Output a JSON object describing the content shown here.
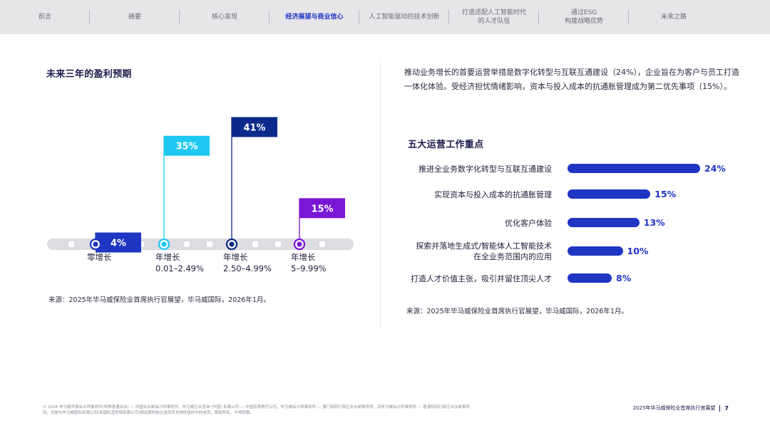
{
  "nav": {
    "items": [
      {
        "label": "前言"
      },
      {
        "label": "摘要"
      },
      {
        "label": "核心发现"
      },
      {
        "label": "经济展望与商业信心",
        "active": true
      },
      {
        "label": "人工智能驱动的技术创新"
      },
      {
        "label": "打造适配人工智能时代\n的人才队伍"
      },
      {
        "label": "通过ESG\n构建战略优势"
      },
      {
        "label": "未来之路"
      }
    ]
  },
  "left": {
    "title": "未来三年的盈利预期",
    "source": "来源：2025年毕马威保险业首席执行官展望，毕马威国际，2026年1月。"
  },
  "right": {
    "intro": "推动业务增长的首要运营举措是数字化转型与互联互通建设（24%），企业旨在为客户与员工打造一体化体验。受经济担忧情绪影响，资本与投入成本的抗通胀管理成为第二优先事项（15%）。",
    "title": "五大运营工作重点",
    "source": "来源：2025年毕马威保险业首席执行官展望，毕马威国际，2026年1月。"
  },
  "chart_data": [
    {
      "type": "bar",
      "categories": [
        "零增长",
        "年增长\n0.01–2.49%",
        "年增长\n2.50–4.99%",
        "年增长\n5–9.99%"
      ],
      "values": [
        4,
        35,
        41,
        15
      ],
      "value_labels": [
        "4%",
        "35%",
        "41%",
        "15%"
      ],
      "colors": [
        "#1f35c4",
        "#1ec8f0",
        "#0b2a8c",
        "#7a16d6"
      ],
      "title": "未来三年的盈利预期",
      "xlabel": "",
      "ylabel": "",
      "ylim": [
        0,
        45
      ],
      "grid": false
    },
    {
      "type": "bar",
      "orientation": "horizontal",
      "categories": [
        "推进全业务数字化转型与互联互通建设",
        "实现资本与投入成本的抗通胀管理",
        "优化客户体验",
        "探索并落地生成式/智能体人工智能技术\n在全业务范围内的应用",
        "打造人才价值主张，吸引并留住顶尖人才"
      ],
      "values": [
        24,
        15,
        13,
        10,
        8
      ],
      "value_labels": [
        "24%",
        "15%",
        "13%",
        "10%",
        "8%"
      ],
      "colors": [
        "#1f35c4"
      ],
      "title": "五大运营工作重点",
      "xlabel": "",
      "ylabel": "",
      "xlim": [
        0,
        24
      ],
      "grid": false
    }
  ],
  "footer": {
    "legal": "© 2026 毕马威华振会计师事务所(特殊普通合伙) — 中国合伙制会计师事务所，毕马威企业咨询 (中国) 有限公司 — 中国有限责任公司，毕马威会计师事务所 — 澳门特别行政区合伙制事务所，及毕马威会计师事务所 — 香港特别行政区合伙制事务所，均是与毕马威国际有限公司(英国私营担保有限公司)相关联的独立成员所全球性组织中的成员。版权所有，不得转载。",
    "report_name": "2025年毕马威保险业首席执行官展望",
    "page_number": "7"
  }
}
